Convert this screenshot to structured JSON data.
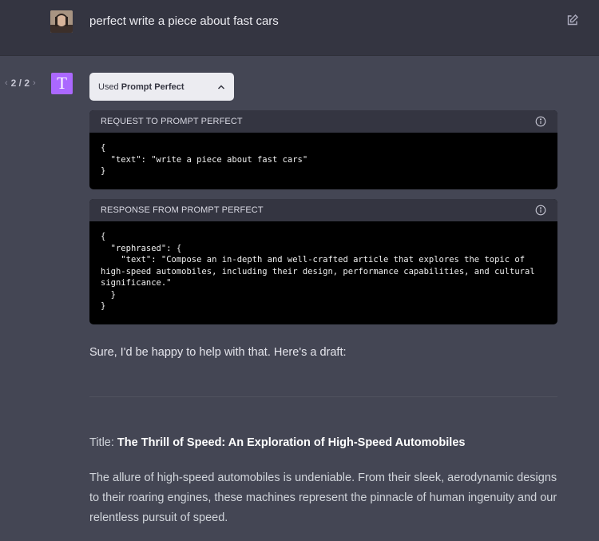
{
  "user_message": {
    "text": "perfect write a piece about fast cars"
  },
  "pager": {
    "label": "2 / 2",
    "prev_icon": "chevron-left-icon",
    "next_icon": "chevron-right-icon"
  },
  "assistant": {
    "avatar_letter": "T",
    "avatar_color": "#ab68ff",
    "plugin": {
      "used_label": "Used",
      "plugin_name": "Prompt Perfect"
    },
    "request_panel": {
      "header": "REQUEST TO PROMPT PERFECT",
      "code": "{\n  \"text\": \"write a piece about fast cars\"\n}"
    },
    "response_panel": {
      "header": "RESPONSE FROM PROMPT PERFECT",
      "code": "{\n  \"rephrased\": {\n    \"text\": \"Compose an in-depth and well-crafted article that explores the topic of high-speed automobiles, including their design, performance capabilities, and cultural significance.\"\n  }\n}"
    },
    "reply_intro": "Sure, I'd be happy to help with that. Here's a draft:",
    "title_prefix": "Title: ",
    "title_text": "The Thrill of Speed: An Exploration of High-Speed Automobiles",
    "paragraph": "The allure of high-speed automobiles is undeniable. From their sleek, aerodynamic designs to their roaring engines, these machines represent the pinnacle of human ingenuity and our relentless pursuit of speed."
  },
  "colors": {
    "page_bg": "#444654",
    "user_row_bg": "#343541",
    "panel_bg": "#000000",
    "panel_header_bg": "#343541",
    "pill_bg": "#ececf1"
  }
}
